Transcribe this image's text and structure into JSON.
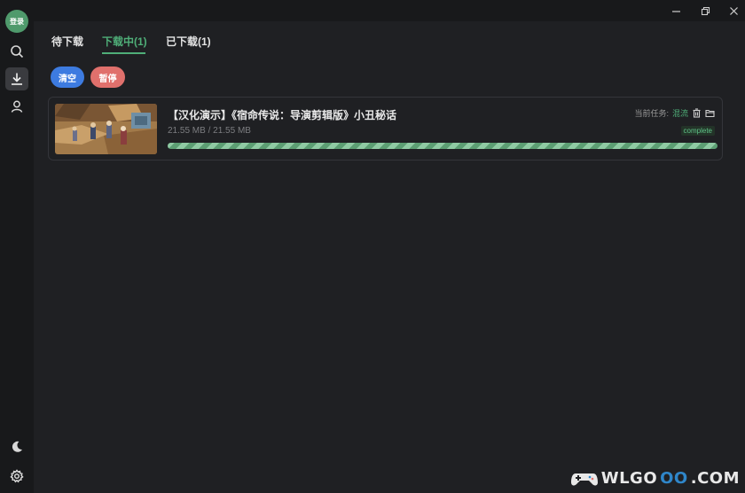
{
  "sidebar": {
    "avatar_label": "登录",
    "items": [
      {
        "name": "search",
        "icon": "search-icon"
      },
      {
        "name": "download",
        "icon": "download-icon",
        "active": true
      },
      {
        "name": "user",
        "icon": "user-icon"
      }
    ],
    "bottom": [
      {
        "name": "theme",
        "icon": "moon-icon"
      },
      {
        "name": "settings",
        "icon": "gear-icon"
      }
    ]
  },
  "window_controls": [
    "minimize-icon",
    "restore-icon",
    "close-icon"
  ],
  "tabs": [
    {
      "label": "待下载",
      "active": false
    },
    {
      "label": "下载中(1)",
      "active": true
    },
    {
      "label": "已下载(1)",
      "active": false
    }
  ],
  "actions": {
    "clear_label": "清空",
    "pause_label": "暂停",
    "clear_color": "#3d7be0",
    "pause_color": "#e0706c"
  },
  "downloads": [
    {
      "title": "【汉化演示】《宿命传说：导演剪辑版》小丑秘话",
      "size": "21.55 MB / 21.55 MB",
      "task_label": "当前任务:",
      "task_value": "混流",
      "status": "complete",
      "progress": 1.0
    }
  ],
  "watermark": {
    "text_a": "WLGO",
    "text_b": "OO",
    "text_c": ".COM"
  },
  "colors": {
    "accent": "#4fae78",
    "background": "#1f2023",
    "sidebar": "#18191b"
  }
}
